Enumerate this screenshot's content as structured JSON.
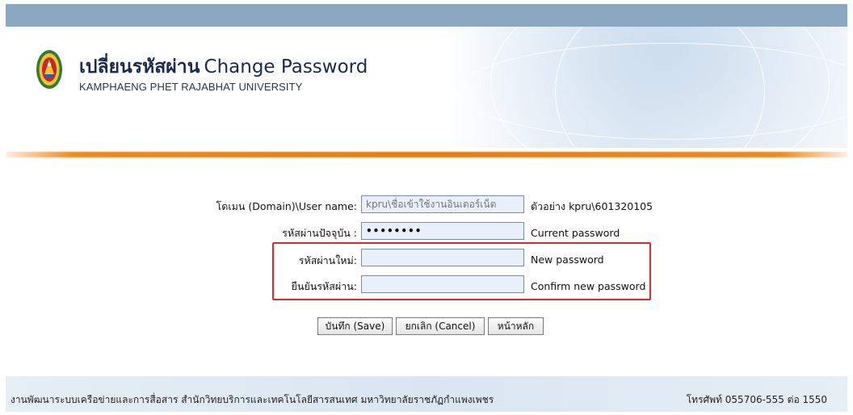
{
  "header": {
    "title_thai": "เปลี่ยนรหัสผ่าน",
    "title_en": "Change Password",
    "subtitle": "KAMPHAENG PHET RAJABHAT UNIVERSITY",
    "logo_icon": "university-seal-icon"
  },
  "form": {
    "username": {
      "label": "โดเมน (Domain)\\User name:",
      "placeholder": "kpru\\ชื่อเข้าใช้งานอินเตอร์เน็ต",
      "value": "",
      "hint": "ตัวอย่าง kpru\\601320105"
    },
    "current_password": {
      "label": "รหัสผ่านปัจจุบัน :",
      "value": "••••••••",
      "hint": "Current password"
    },
    "new_password": {
      "label": "รหัสผ่านใหม่:",
      "value": "",
      "hint": "New password"
    },
    "confirm_password": {
      "label": "ยืนยันรหัสผ่าน:",
      "value": "",
      "hint": "Confirm new password"
    }
  },
  "buttons": {
    "save": "บันทึก (Save)",
    "cancel": "ยกเลิก (Cancel)",
    "home": "หน้าหลัก"
  },
  "footer": {
    "left": "งานพัฒนาระบบเครือข่ายและการสื่อสาร สำนักวิทยบริการและเทคโนโลยีสารสนเทศ มหาวิทยาลัยราชภัฏกำแพงเพชร",
    "right": "โทรศัพท์ 055706-555 ต่อ 1550"
  },
  "colors": {
    "top_bar": "#8aa8c2",
    "accent_orange": "#e97d0f",
    "highlight_red": "#e02828",
    "input_bg": "#e9f0fb",
    "title_text": "#1a2a52"
  }
}
